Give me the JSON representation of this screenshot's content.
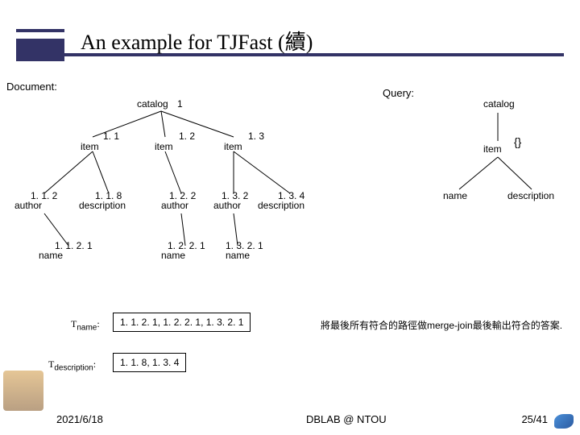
{
  "title": "An example for TJFast (續)",
  "labels": {
    "document": "Document:",
    "query": "Query:"
  },
  "doc": {
    "root": {
      "t": "catalog",
      "id": "1"
    },
    "i1": {
      "t": "item",
      "id": "1. 1"
    },
    "i2": {
      "t": "item",
      "id": "1. 2"
    },
    "i3": {
      "t": "item",
      "id": "1. 3"
    },
    "a1": {
      "t": "author",
      "id": "1. 1. 2"
    },
    "d1": {
      "t": "description",
      "id": "1. 1. 8"
    },
    "a2": {
      "t": "author",
      "id": "1. 2. 2"
    },
    "a3": {
      "t": "author",
      "id": "1. 3. 2"
    },
    "d2": {
      "t": "description",
      "id": "1. 3. 4"
    },
    "n1": {
      "t": "name",
      "id": "1. 1. 2. 1"
    },
    "n2": {
      "t": "name",
      "id": "1. 2. 2. 1"
    },
    "n3": {
      "t": "name",
      "id": "1. 3. 2. 1"
    }
  },
  "query": {
    "root": "catalog",
    "item": "item",
    "brace": "{}",
    "name": "name",
    "desc": "description"
  },
  "results": {
    "tname_label": "Tname:",
    "tname_val": "1. 1. 2. 1,  1. 2. 2. 1, 1. 3. 2. 1",
    "tdesc_label": "Tdescription:",
    "tdesc_val": "1. 1. 8,  1. 3. 4"
  },
  "note": "將最後所有符合的路徑做merge-join最後輸出符合的答案.",
  "footer": {
    "date": "2021/6/18",
    "org": "DBLAB @ NTOU",
    "page": "25/41"
  }
}
